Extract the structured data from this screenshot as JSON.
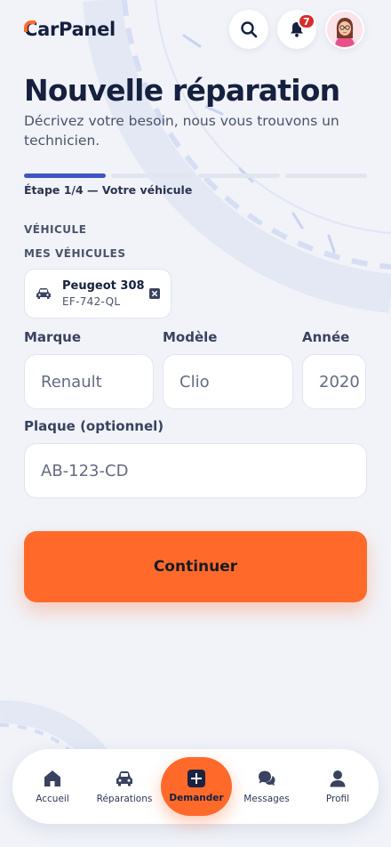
{
  "app": {
    "logo_text": "CarPanel"
  },
  "header": {
    "notifications_count": "7"
  },
  "page": {
    "title": "Nouvelle réparation",
    "subtitle": "Décrivez votre besoin, nous vous trouvons un technicien."
  },
  "progress": {
    "current_step": 1,
    "total_steps": 4,
    "label": "Étape 1/4 — Votre véhicule"
  },
  "vehicle_section": {
    "heading": "VÉHICULE",
    "my_vehicles_label": "MES VÉHICULES",
    "saved_vehicle": {
      "name": "Peugeot 308",
      "plate": "EF-742-QL"
    }
  },
  "form": {
    "brand": {
      "label": "Marque",
      "placeholder": "Renault"
    },
    "model": {
      "label": "Modèle",
      "placeholder": "Clio"
    },
    "year": {
      "label": "Année",
      "placeholder": "2020"
    },
    "plate": {
      "label": "Plaque (optionnel)",
      "placeholder": "AB-123-CD"
    }
  },
  "actions": {
    "continue_label": "Continuer"
  },
  "bottom_nav": {
    "items": [
      {
        "label": "Accueil",
        "icon": "home-icon"
      },
      {
        "label": "Réparations",
        "icon": "car-icon"
      },
      {
        "label": "Demander",
        "icon": "plus-square-icon"
      },
      {
        "label": "Messages",
        "icon": "chat-bubbles-icon"
      },
      {
        "label": "Profil",
        "icon": "user-icon"
      }
    ]
  },
  "colors": {
    "accent": "#ff6a2b",
    "primary": "#3d55c7",
    "text": "#16203f",
    "badge": "#d92d2d",
    "background": "#f1f3f9"
  }
}
